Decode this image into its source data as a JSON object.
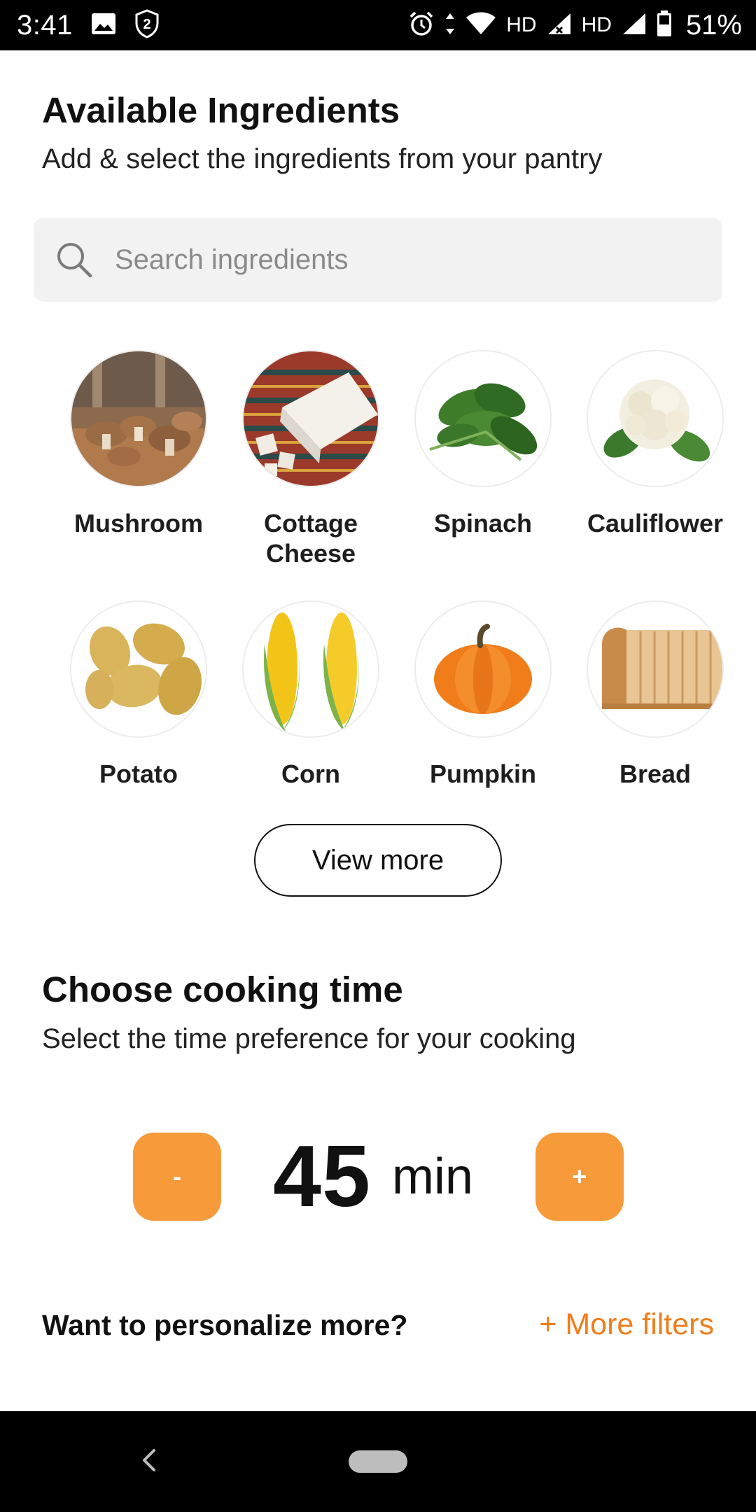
{
  "status_bar": {
    "time": "3:41",
    "hd1": "HD",
    "hd2": "HD",
    "battery": "51%",
    "icons": [
      "image-icon",
      "shield-2-icon",
      "alarm-icon",
      "data-arrows-icon",
      "wifi-icon",
      "signal-icon",
      "signal-icon",
      "battery-icon"
    ]
  },
  "ingredients_section": {
    "title": "Available Ingredients",
    "subtitle": "Add & select the ingredients from your pantry",
    "search_placeholder": "Search ingredients",
    "items": [
      {
        "label": "Mushroom"
      },
      {
        "label": "Cottage Cheese"
      },
      {
        "label": "Spinach"
      },
      {
        "label": "Cauliflower"
      },
      {
        "label": "Potato"
      },
      {
        "label": "Corn"
      },
      {
        "label": "Pumpkin"
      },
      {
        "label": "Bread"
      }
    ],
    "view_more": "View more"
  },
  "cooking_time": {
    "title": "Choose cooking time",
    "subtitle": "Select the time preference for your cooking",
    "value": "45",
    "unit": "min",
    "decrement_label": "-",
    "increment_label": "+"
  },
  "personalize": {
    "question": "Want to personalize more?",
    "more_filters": "+ More filters"
  },
  "colors": {
    "accent": "#f79a3a",
    "link": "#f07d1a"
  }
}
